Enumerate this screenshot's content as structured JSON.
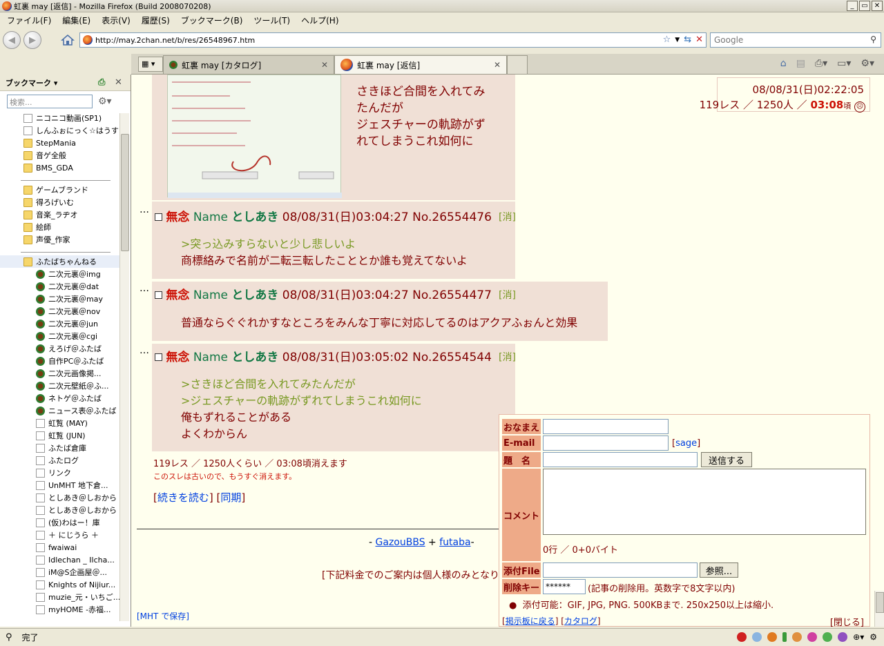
{
  "window": {
    "title": "虹裏 may [返信] - Mozilla Firefox (Build 2008070208)",
    "btn_min": "_",
    "btn_max": "▭",
    "btn_close": "✕"
  },
  "menu": [
    "ファイル(F)",
    "編集(E)",
    "表示(V)",
    "履歴(S)",
    "ブックマーク(B)",
    "ツール(T)",
    "ヘルプ(H)"
  ],
  "nav": {
    "back": "◀",
    "forward": "▶",
    "url": "http://may.2chan.net/b/res/26548967.htm",
    "search_placeholder": "Google"
  },
  "tabs": [
    {
      "label": "虹裏 may [カタログ]"
    },
    {
      "label": "虹裏 may [返信]"
    }
  ],
  "sidebar": {
    "title": "ブックマーク ▾",
    "search_placeholder": "検索...",
    "items": [
      {
        "label": "ニコニコ動画(SP1)",
        "icon": "page"
      },
      {
        "label": "しんふぉにっく☆はうす",
        "icon": "page"
      },
      {
        "label": "StepMania",
        "icon": "folder"
      },
      {
        "label": "音ゲ全般",
        "icon": "folder"
      },
      {
        "label": "BMS_GDA",
        "icon": "folder"
      },
      {
        "label": "",
        "icon": "separator"
      },
      {
        "label": "ゲームブランド",
        "icon": "folder"
      },
      {
        "label": "得ろげいむ",
        "icon": "folder"
      },
      {
        "label": "音楽_ラヂオ",
        "icon": "folder"
      },
      {
        "label": "絵師",
        "icon": "folder"
      },
      {
        "label": "声優_作家",
        "icon": "folder"
      },
      {
        "label": "",
        "icon": "separator"
      },
      {
        "label": "ふたばちゃんねる",
        "icon": "folder"
      },
      {
        "label": "二次元裏＠img",
        "icon": "futaba"
      },
      {
        "label": "二次元裏＠dat",
        "icon": "futaba"
      },
      {
        "label": "二次元裏＠may",
        "icon": "futaba"
      },
      {
        "label": "二次元裏＠nov",
        "icon": "futaba"
      },
      {
        "label": "二次元裏＠jun",
        "icon": "futaba"
      },
      {
        "label": "二次元裏＠cgi",
        "icon": "futaba"
      },
      {
        "label": "えろげ＠ふたば",
        "icon": "futaba"
      },
      {
        "label": "自作PC＠ふたば",
        "icon": "futaba"
      },
      {
        "label": "二次元画像掲...",
        "icon": "futaba"
      },
      {
        "label": "二次元壁紙＠ふ...",
        "icon": "futaba"
      },
      {
        "label": "ネトゲ＠ふたば",
        "icon": "futaba"
      },
      {
        "label": "ニュース表＠ふたば",
        "icon": "futaba"
      },
      {
        "label": "虹覧 (MAY)",
        "icon": "page"
      },
      {
        "label": "虹覧 (JUN)",
        "icon": "page"
      },
      {
        "label": "ふたば倉庫",
        "icon": "page"
      },
      {
        "label": "ふたログ",
        "icon": "page"
      },
      {
        "label": "リンク",
        "icon": "page"
      },
      {
        "label": "UnMHT 地下倉...",
        "icon": "page"
      },
      {
        "label": "としあき＠しおから",
        "icon": "page"
      },
      {
        "label": "としあき＠しおから",
        "icon": "page"
      },
      {
        "label": "(仮)わはー！庫",
        "icon": "page"
      },
      {
        "label": "＋ にじうら ＋",
        "icon": "page"
      },
      {
        "label": "fwaiwai",
        "icon": "page"
      },
      {
        "label": "Idlechan _ Ilcha...",
        "icon": "page"
      },
      {
        "label": "iM@S企画屋＠...",
        "icon": "page"
      },
      {
        "label": "Knights of Nijiur...",
        "icon": "page"
      },
      {
        "label": "muzie_元・いちご...",
        "icon": "page"
      },
      {
        "label": "myHOME -赤福...",
        "icon": "page"
      }
    ]
  },
  "thread": {
    "top_post_lines": [
      "さきほど合間を入れてみ",
      "たんだが",
      "ジェスチャーの軌跡がず",
      "れてしまうこれ如何に"
    ],
    "header_time": "08/08/31(日)02:22:05",
    "header_count": "119レス ／ 1250人 ／",
    "header_expire": "03:08",
    "header_expire_suffix": "頃",
    "posts": [
      {
        "dots": "…",
        "subject": "無念",
        "name_label": "Name",
        "name": "としあき",
        "datetime": "08/08/31(日)03:04:27",
        "no": "No.26554476",
        "del": "[消]",
        "lines": [
          {
            "t": ">突っ込みすらないと少し悲しいよ",
            "q": true
          },
          {
            "t": "商標絡みで名前が二転三転したこととか誰も覚えてないよ",
            "q": false
          }
        ]
      },
      {
        "dots": "…",
        "subject": "無念",
        "name_label": "Name",
        "name": "としあき",
        "datetime": "08/08/31(日)03:04:27",
        "no": "No.26554477",
        "del": "[消]",
        "lines": [
          {
            "t": "普通ならぐぐれかすなところをみんな丁寧に対応してるのはアクアふぉんと効果",
            "q": false
          }
        ]
      },
      {
        "dots": "…",
        "subject": "無念",
        "name_label": "Name",
        "name": "としあき",
        "datetime": "08/08/31(日)03:05:02",
        "no": "No.26554544",
        "del": "[消]",
        "lines": [
          {
            "t": ">さきほど合間を入れてみたんだが",
            "q": true
          },
          {
            "t": ">ジェスチャーの軌跡がずれてしまうこれ如何に",
            "q": true
          },
          {
            "t": "俺もずれることがある",
            "q": false
          },
          {
            "t": "よくわからん",
            "q": false
          }
        ]
      }
    ],
    "footer_count": "119レス ／ 1250人くらい ／ 03:08頃消えます",
    "footer_warning": "このスレは古いので、もうすぐ消えます。",
    "read_more": "続きを読む",
    "sync": "同期",
    "credit_pre": "- ",
    "credit_gazou": "GazouBBS",
    "credit_plus": " + ",
    "credit_futaba": "futaba",
    "credit_post": "-",
    "ad_text": "[下記料金でのご案内は個人様のみとなり",
    "mht_save": "[MHT で保存]"
  },
  "form": {
    "name_label": "おなまえ",
    "email_label": "E-mail",
    "sage": "sage",
    "subject_label": "題　名",
    "submit": "送信する",
    "comment_label": "コメント",
    "counter": "0行 ／ 0+0バイト",
    "file_label": "添付File",
    "browse": "参照...",
    "delkey_label": "削除キー",
    "delkey_value": "******",
    "delkey_note": "(記事の削除用。英数字で8文字以内)",
    "note": "添付可能：GIF, JPG, PNG. 500KBまで. 250x250以上は縮小.",
    "back_link": "掲示板に戻る",
    "catalog_link": "カタログ",
    "close": "閉じる"
  },
  "status": {
    "text": "完了"
  }
}
